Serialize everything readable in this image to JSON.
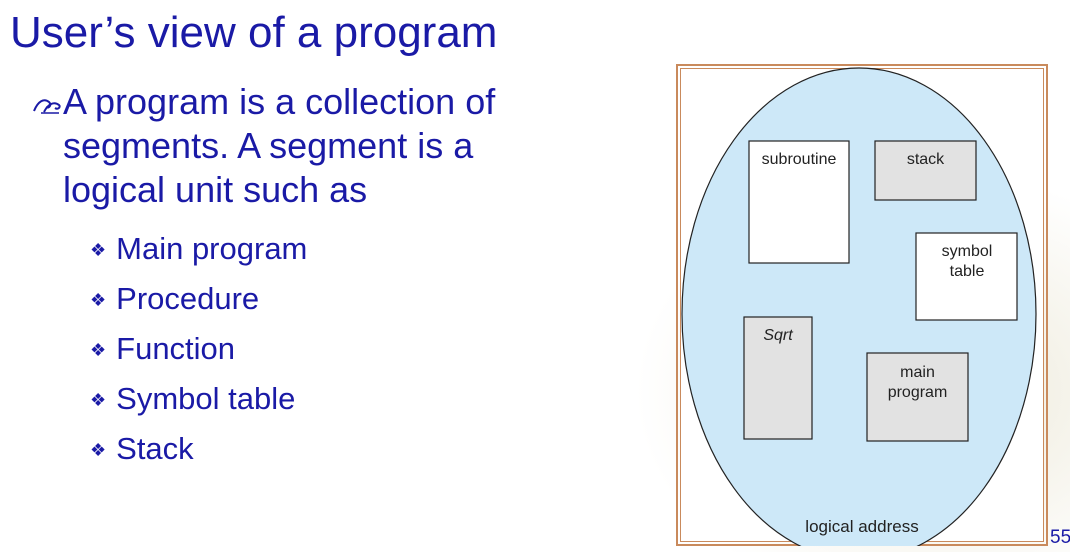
{
  "slide": {
    "title": "User’s view of a program",
    "main_bullet": "A program is a collection of segments. A segment is a logical unit such as",
    "sub_bullets": [
      "Main program",
      "Procedure",
      "Function",
      "Symbol table",
      "Stack"
    ],
    "page_number": "55"
  },
  "diagram": {
    "caption": "logical address",
    "segments": {
      "subroutine": "subroutine",
      "stack": "stack",
      "symbol_table": "symbol table",
      "sqrt": "Sqrt",
      "main_program": "main program"
    }
  },
  "colors": {
    "text_blue": "#1a1aa6",
    "ellipse_fill": "#cde8f8",
    "frame_border": "#c98a5c",
    "shaded_box": "#e2e2e2"
  },
  "icons": {
    "main_bullet": "swirl-bullet-icon",
    "sub_bullet": "diamond-bullet-icon"
  }
}
